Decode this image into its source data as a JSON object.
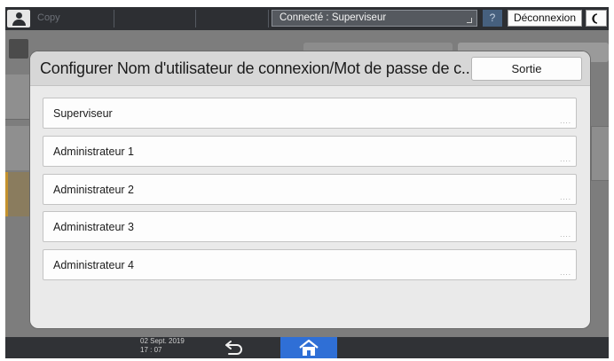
{
  "topbar": {
    "app_label": "Copy",
    "login_status": "Connecté : Superviseur",
    "help_label": "?",
    "logout_label": "Déconnexion",
    "energy_label": "(",
    "user_icon": "user-icon"
  },
  "dialog": {
    "title": "Configurer Nom d'utilisateur de connexion/Mot de passe de c...",
    "exit_label": "Sortie",
    "rows": [
      {
        "label": "Superviseur"
      },
      {
        "label": "Administrateur 1"
      },
      {
        "label": "Administrateur 2"
      },
      {
        "label": "Administrateur 3"
      },
      {
        "label": "Administrateur 4"
      }
    ],
    "row_more_glyph": "...."
  },
  "bottombar": {
    "date": "02 Sept. 2019",
    "time": "17 : 07",
    "back_icon": "back-arrow-icon",
    "home_icon": "home-icon"
  },
  "colors": {
    "home_accent": "#2f6fd6",
    "help_accent": "#46607e"
  }
}
